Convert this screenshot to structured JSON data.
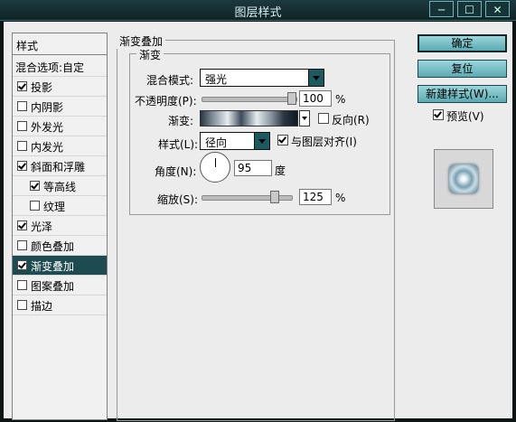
{
  "window": {
    "title": "图层样式"
  },
  "styles_list": {
    "header": "样式",
    "blend_options": "混合选项:自定",
    "items": [
      {
        "label": "投影",
        "checked": true
      },
      {
        "label": "内阴影",
        "checked": false
      },
      {
        "label": "外发光",
        "checked": false
      },
      {
        "label": "内发光",
        "checked": false
      },
      {
        "label": "斜面和浮雕",
        "checked": true
      },
      {
        "label": "等高线",
        "checked": true
      },
      {
        "label": "纹理",
        "checked": false
      },
      {
        "label": "光泽",
        "checked": true
      },
      {
        "label": "颜色叠加",
        "checked": false
      },
      {
        "label": "渐变叠加",
        "checked": true,
        "selected": true
      },
      {
        "label": "图案叠加",
        "checked": false
      },
      {
        "label": "描边",
        "checked": false
      }
    ]
  },
  "panel": {
    "group_title": "渐变叠加",
    "inner_title": "渐变",
    "blend_mode_label": "混合模式:",
    "blend_mode_value": "强光",
    "opacity_label": "不透明度(P):",
    "opacity_value": "100",
    "opacity_unit": "%",
    "opacity_level": 1.0,
    "gradient_label": "渐变:",
    "reverse_label": "反向(R)",
    "reverse_checked": false,
    "style_label": "样式(L):",
    "style_value": "径向",
    "align_label": "与图层对齐(I)",
    "align_checked": true,
    "angle_label": "角度(N):",
    "angle_value": "95",
    "angle_unit": "度",
    "scale_label": "缩放(S):",
    "scale_value": "125",
    "scale_unit": "%"
  },
  "buttons": {
    "ok": "确定",
    "reset": "复位",
    "new_style": "新建样式(W)...",
    "preview_label": "预览(V)",
    "preview_checked": true
  },
  "colors": {
    "accent": "#1e4b50",
    "button": "#7cc2c8"
  }
}
